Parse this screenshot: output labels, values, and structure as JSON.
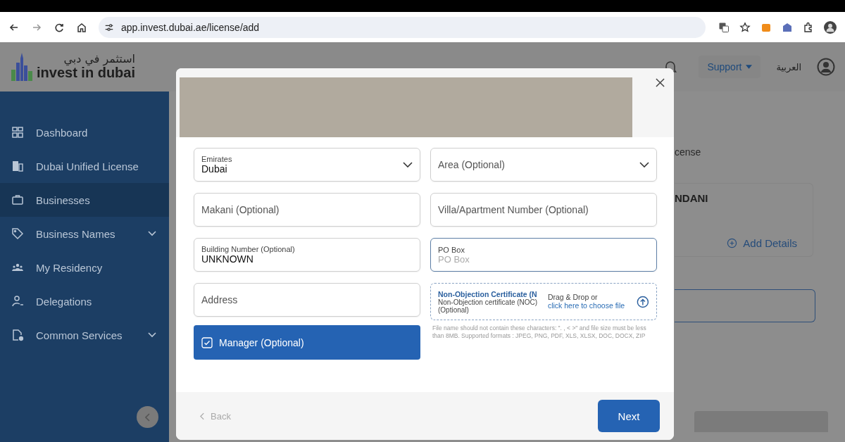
{
  "browser": {
    "url": "app.invest.dubai.ae/license/add"
  },
  "header": {
    "logo_arabic": "استثمر في دبي",
    "logo_text": "invest in dubai",
    "support": "Support",
    "language": "العربية"
  },
  "sidebar": {
    "items": [
      {
        "label": "Dashboard",
        "selected": false,
        "expandable": false
      },
      {
        "label": "Dubai Unified License",
        "selected": false,
        "expandable": false
      },
      {
        "label": "Businesses",
        "selected": true,
        "expandable": false
      },
      {
        "label": "Business Names",
        "selected": false,
        "expandable": true
      },
      {
        "label": "My Residency",
        "selected": false,
        "expandable": false
      },
      {
        "label": "Delegations",
        "selected": false,
        "expandable": false
      },
      {
        "label": "Common Services",
        "selected": false,
        "expandable": true
      }
    ]
  },
  "background": {
    "text_1": "cense",
    "card_title": "NDANI",
    "add_details": "Add Details"
  },
  "modal": {
    "fields": [
      {
        "kind": "select",
        "label": "Emirates",
        "value": "Dubai",
        "focused": false
      },
      {
        "kind": "select",
        "placeholder": "Area (Optional)",
        "focused": false
      },
      {
        "kind": "text",
        "placeholder": "Makani (Optional)",
        "focused": false
      },
      {
        "kind": "text",
        "placeholder": "Villa/Apartment Number (Optional)",
        "focused": false
      },
      {
        "kind": "text",
        "label": "Building Number (Optional)",
        "value": "UNKNOWN",
        "focused": false
      },
      {
        "kind": "text",
        "label": "PO Box",
        "placeholder": "PO Box",
        "focused": true
      },
      {
        "kind": "text",
        "placeholder": "Address",
        "focused": false
      },
      {
        "kind": "upload",
        "title": "Non-Objection Certificate (N",
        "subtitle": "Non-Objection certificate (NOC) (Optional)",
        "drop_text": "Drag & Drop or",
        "link": "click here to choose file",
        "note": "File name should not contain these characters: \". , < >\" and file size must be less than 8MB. Supported formats : JPEG, PNG, PDF, XLS, XLSX, DOC, DOCX, ZIP"
      }
    ],
    "manager": {
      "label": "Manager (Optional)",
      "checked": true
    },
    "back": "Back",
    "next": "Next"
  }
}
